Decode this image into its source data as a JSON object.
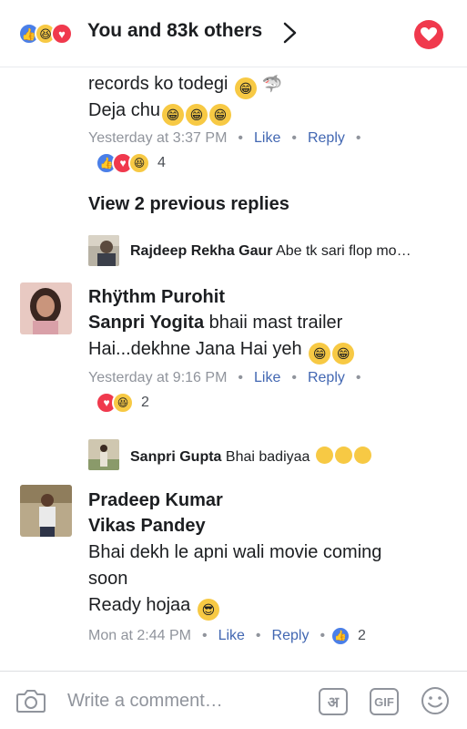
{
  "colors": {
    "like_blue": "#4a7fe8",
    "love_red": "#f0394d",
    "haha_yellow": "#f7c944",
    "meta_gray": "#90949c",
    "link_blue": "#4267b2",
    "text_dark": "#1c1e21"
  },
  "header": {
    "reactions": [
      "like-icon",
      "haha-icon",
      "love-icon"
    ],
    "title": "You and 83k others",
    "chevron_icon": "chevron-right-icon",
    "action_icon": "heart-icon"
  },
  "top_comment": {
    "line1": "records ko todegi",
    "line2": "Deja chu",
    "time": "Yesterday at 3:37 PM",
    "like": "Like",
    "reply": "Reply",
    "reaction_count": "4"
  },
  "view_previous": "View 2 previous replies",
  "reply1": {
    "name": "Rajdeep Rekha Gaur",
    "text": "Abe tk sari flop mo…"
  },
  "comment2": {
    "author": "Rhÿthm Purohit",
    "mention": "Sanpri Yogita",
    "text1": " bhaii mast trailer",
    "text2": "Hai...dekhne Jana Hai yeh",
    "time": "Yesterday at 9:16 PM",
    "like": "Like",
    "reply": "Reply",
    "reaction_count": "2"
  },
  "reply2": {
    "name": "Sanpri Gupta",
    "text": "Bhai badiyaa"
  },
  "comment3": {
    "author": "Pradeep Kumar",
    "mention": "Vikas Pandey",
    "text1": "Bhai dekh le apni wali movie coming",
    "text2": "soon",
    "text3": "Ready hojaa",
    "time": "Mon at 2:44 PM",
    "like": "Like",
    "reply": "Reply",
    "reaction_count": "2"
  },
  "composer": {
    "placeholder": "Write a comment…",
    "hindi_label": "अ",
    "gif_label": "GIF"
  }
}
